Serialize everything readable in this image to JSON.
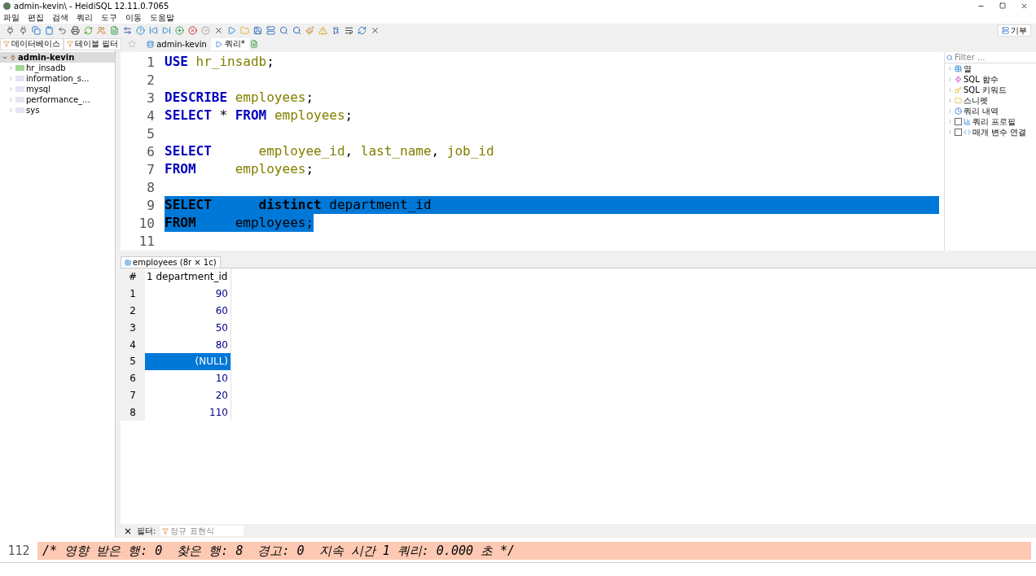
{
  "window": {
    "title": "admin-kevin\\ - HeidiSQL 12.11.0.7065"
  },
  "menu": [
    "파일",
    "편집",
    "검색",
    "쿼리",
    "도구",
    "이동",
    "도움말"
  ],
  "donate_button": {
    "label": "기부"
  },
  "left_tabs": [
    {
      "label": "데이터베이스"
    },
    {
      "label": "테이블 필터"
    }
  ],
  "query_tabs": [
    {
      "label": "admin-kevin",
      "kind": "host",
      "selected": false
    },
    {
      "label": "쿼리*",
      "kind": "query",
      "selected": true
    }
  ],
  "tree": {
    "label": "admin-kevin",
    "expanded": true,
    "children": [
      {
        "label": "hr_insadb",
        "active": true
      },
      {
        "label": "information_s...",
        "active": false
      },
      {
        "label": "mysql",
        "active": false
      },
      {
        "label": "performance_...",
        "active": false
      },
      {
        "label": "sys",
        "active": false
      }
    ]
  },
  "editor": {
    "lines": [
      {
        "number": "1",
        "selected": false,
        "tokens": [
          {
            "kind": "kw",
            "text": "USE "
          },
          {
            "kind": "id",
            "text": "hr_insadb"
          },
          {
            "kind": "plain",
            "text": ";"
          }
        ]
      },
      {
        "number": "2",
        "selected": false
      },
      {
        "number": "3",
        "selected": false,
        "tokens": [
          {
            "kind": "kw",
            "text": "DESCRIBE "
          },
          {
            "kind": "id",
            "text": "employees"
          },
          {
            "kind": "plain",
            "text": ";"
          }
        ]
      },
      {
        "number": "4",
        "selected": false,
        "tokens": [
          {
            "kind": "kw",
            "text": "SELECT "
          },
          {
            "kind": "plain",
            "text": "* "
          },
          {
            "kind": "kw",
            "text": "FROM "
          },
          {
            "kind": "id",
            "text": "employees"
          },
          {
            "kind": "plain",
            "text": ";"
          }
        ]
      },
      {
        "number": "5",
        "selected": false
      },
      {
        "number": "6",
        "selected": false,
        "tokens": [
          {
            "kind": "kw",
            "text": "SELECT      "
          },
          {
            "kind": "id",
            "text": "employee_id"
          },
          {
            "kind": "plain",
            "text": ", "
          },
          {
            "kind": "id",
            "text": "last_name"
          },
          {
            "kind": "plain",
            "text": ", "
          },
          {
            "kind": "id",
            "text": "job_id"
          }
        ]
      },
      {
        "number": "7",
        "selected": false,
        "tokens": [
          {
            "kind": "kw",
            "text": "FROM     "
          },
          {
            "kind": "id",
            "text": "employees"
          },
          {
            "kind": "plain",
            "text": ";"
          }
        ]
      },
      {
        "number": "8",
        "selected": false
      },
      {
        "number": "9",
        "selected": true,
        "full": true,
        "tokens": [
          {
            "kind": "kw",
            "text": "SELECT      "
          },
          {
            "kind": "kw",
            "text": "distinct "
          },
          {
            "kind": "id",
            "text": "department_id"
          }
        ]
      },
      {
        "number": "10",
        "selected": true,
        "full": false,
        "tokens": [
          {
            "kind": "kw",
            "text": "FROM     "
          },
          {
            "kind": "id",
            "text": "employees"
          },
          {
            "kind": "plain",
            "text": ";"
          }
        ]
      },
      {
        "number": "11",
        "selected": false
      }
    ]
  },
  "helper": {
    "filter_placeholder": "Filter ...",
    "items": [
      {
        "label": "열",
        "kind": "columns"
      },
      {
        "label": "SQL 함수",
        "kind": "functions"
      },
      {
        "label": "SQL 키워드",
        "kind": "keywords"
      },
      {
        "label": "스니펫",
        "kind": "snippets"
      },
      {
        "label": "쿼리 내역",
        "kind": "history"
      },
      {
        "label": "쿼리 프로필",
        "kind": "profile",
        "checked": false
      },
      {
        "label": "매개 변수 연결",
        "kind": "params",
        "checked": false
      }
    ]
  },
  "result_tab": {
    "label": "employees (8r × 1c)"
  },
  "result": {
    "columns": [
      "#",
      "1 department_id"
    ],
    "rows": [
      {
        "number": "1",
        "value": "90",
        "selected": false
      },
      {
        "number": "2",
        "value": "60",
        "selected": false
      },
      {
        "number": "3",
        "value": "50",
        "selected": false
      },
      {
        "number": "4",
        "value": "80",
        "selected": false
      },
      {
        "number": "5",
        "value": "(NULL)",
        "selected": true
      },
      {
        "number": "6",
        "value": "10",
        "selected": false
      },
      {
        "number": "7",
        "value": "20",
        "selected": false
      },
      {
        "number": "8",
        "value": "110",
        "selected": false
      }
    ]
  },
  "filter_bar": {
    "close": "×",
    "label": "필터:",
    "placeholder": "정규 표현식"
  },
  "log": {
    "line_number": "112",
    "text": "/* 영향 받은 행: 0  찾은 행: 8  경고: 0  지속 시간 1 쿼리: 0.000 초 */"
  }
}
